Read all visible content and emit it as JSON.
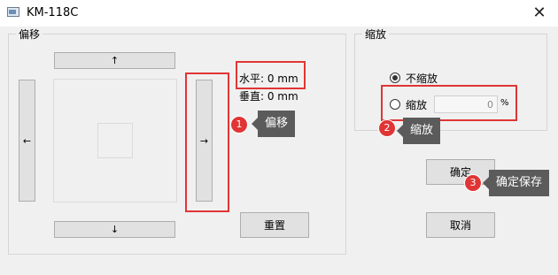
{
  "window": {
    "title": "KM-118C",
    "close_glyph": "✕"
  },
  "offset_group": {
    "label": "偏移",
    "up_glyph": "↑",
    "down_glyph": "↓",
    "left_glyph": "←",
    "right_glyph": "→",
    "horizontal_text": "水平: 0 mm",
    "vertical_text": "垂直: 0 mm",
    "reset_label": "重置"
  },
  "scale_group": {
    "label": "缩放",
    "no_scale_label": "不缩放",
    "scale_label": "缩放",
    "scale_value": "0",
    "scale_unit": "%",
    "selected_option": "不缩放"
  },
  "buttons": {
    "ok_label": "确定",
    "cancel_label": "取消"
  },
  "annotations": [
    {
      "number": "1",
      "text": "偏移"
    },
    {
      "number": "2",
      "text": "缩放"
    },
    {
      "number": "3",
      "text": "确定保存"
    }
  ],
  "colors": {
    "highlight": "#e03535",
    "tooltip_bg": "#5b5b5b",
    "window_bg": "#f0f0f0"
  }
}
